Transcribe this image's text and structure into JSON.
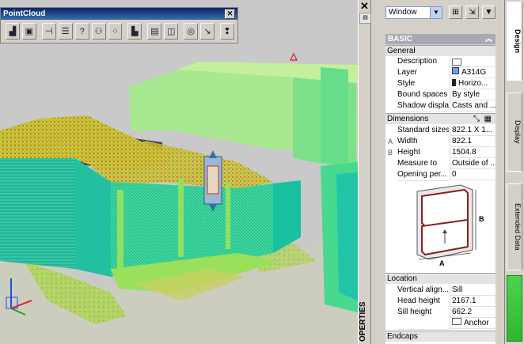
{
  "toolbar": {
    "title": "PointCloud",
    "buttons": [
      "pointcloud-attach-icon",
      "pointcloud-index-icon",
      "section-line-icon",
      "list-icon",
      "help-icon",
      "crop-icon",
      "scatter-icon",
      "import-icon",
      "layer-icon",
      "tag-icon",
      "orbit-icon",
      "paste-icon",
      "bulb-icon"
    ]
  },
  "palette": {
    "strip_label": "OPERTIES",
    "type_select": "Window",
    "basic_header": "BASIC",
    "sections": {
      "general": "General",
      "dimensions": "Dimensions",
      "location": "Location",
      "endcaps": "Endcaps"
    },
    "general_rows": [
      {
        "label": "Description",
        "value": ""
      },
      {
        "label": "Layer",
        "value": "A314G"
      },
      {
        "label": "Style",
        "value": "Horizo..."
      },
      {
        "label": "Bound spaces",
        "value": "By style"
      },
      {
        "label": "Shadow display",
        "value": "Casts and ..."
      }
    ],
    "dimension_rows": [
      {
        "mark": "",
        "label": "Standard sizes",
        "value": "822.1 X 1..."
      },
      {
        "mark": "A",
        "label": "Width",
        "value": "822.1"
      },
      {
        "mark": "B",
        "label": "Height",
        "value": "1504.8"
      },
      {
        "mark": "",
        "label": "Measure to",
        "value": "Outside of ..."
      },
      {
        "mark": "",
        "label": "Opening per...",
        "value": "0"
      }
    ],
    "diagram_labels": {
      "a": "A",
      "b": "B"
    },
    "location_rows": [
      {
        "label": "Vertical align...",
        "value": "Sill"
      },
      {
        "label": "Head height",
        "value": "2167.1"
      },
      {
        "label": "Sill height",
        "value": "662.2"
      },
      {
        "label": "",
        "value": "Anchor"
      }
    ]
  },
  "tabs": {
    "design": "Design",
    "display": "Display",
    "extended_data": "Extended Data"
  }
}
